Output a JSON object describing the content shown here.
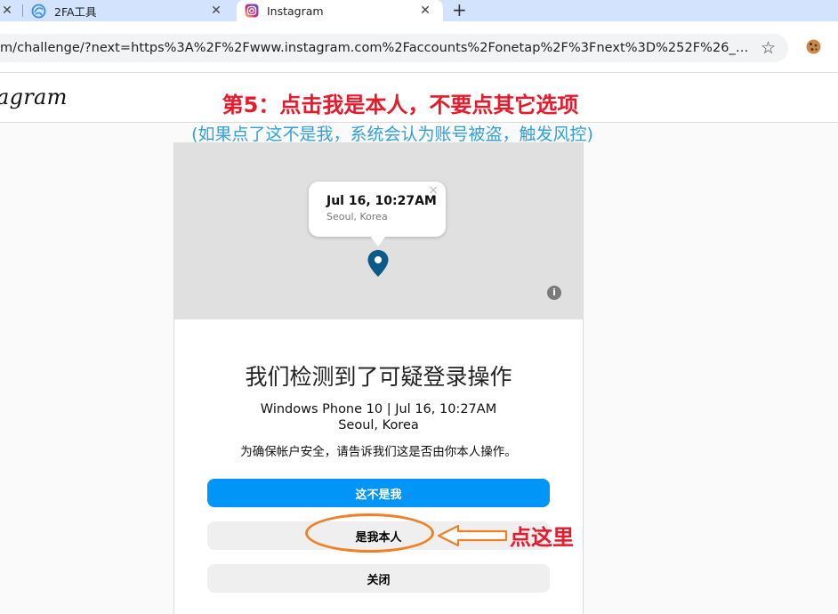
{
  "browser": {
    "tabs": [
      {
        "title": "",
        "close": "✕"
      },
      {
        "title": "2FA工具",
        "close": "✕"
      },
      {
        "title": "Instagram",
        "close": "✕"
      }
    ],
    "new_tab": "+",
    "url": "m/challenge/?next=https%3A%2F%2Fwww.instagram.com%2Faccounts%2Fonetap%2F%3Fnext%3D%252F%26__coig_challen...",
    "bookmark_icon": "star-icon",
    "extension_icon": "cookie-icon"
  },
  "instagram": {
    "logo": "agram"
  },
  "annotation": {
    "step_title": "第5：点击我是本人，不要点其它选项",
    "step_subtitle": "(如果点了这不是我，系统会认为账号被盗，触发风控)",
    "click_here": "点这里",
    "highlight_color": "#f08023",
    "text_color": "#e8192b",
    "subtitle_color": "#32a0d8"
  },
  "map": {
    "popup_time": "Jul 16, 10:27AM",
    "popup_location": "Seoul, Korea",
    "popup_close": "×",
    "pin_icon": "map-pin-icon",
    "info_icon": "i"
  },
  "challenge": {
    "headline": "我们检测到了可疑登录操作",
    "device": "Windows Phone 10 | Jul 16, 10:27AM",
    "location": "Seoul, Korea",
    "description": "为确保帐户安全，请告诉我们这是否由你本人操作。",
    "not_me_button": "这不是我",
    "this_was_me_button": "是我本人",
    "close_button": "关闭",
    "primary_color": "#0095f6"
  }
}
